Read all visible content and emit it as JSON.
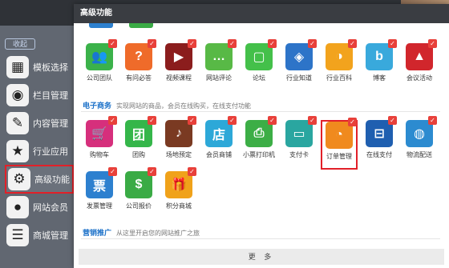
{
  "sidebar": {
    "collapse_label": "收起",
    "items": [
      {
        "label": "模板选择",
        "icon": "grid-icon",
        "glyph": "▦"
      },
      {
        "label": "栏目管理",
        "icon": "target-icon",
        "glyph": "◉"
      },
      {
        "label": "内容管理",
        "icon": "edit-icon",
        "glyph": "✎"
      },
      {
        "label": "行业应用",
        "icon": "star-icon",
        "glyph": "★"
      },
      {
        "label": "高级功能",
        "icon": "gear-icon",
        "glyph": "⚙"
      },
      {
        "label": "网站会员",
        "icon": "user-icon",
        "glyph": "●"
      },
      {
        "label": "商城管理",
        "icon": "cart-icon",
        "glyph": "☰"
      }
    ]
  },
  "modal": {
    "title": "高级功能",
    "more_label": "更 多"
  },
  "sections": {
    "ecommerce": {
      "title": "电子商务",
      "subtitle": "实现网站的商品，会员在线购买，在线支付功能"
    },
    "marketing": {
      "title": "营销推广",
      "subtitle": "从这里开启您的网站推广之旅"
    }
  },
  "apps_row1": [
    {
      "name": "公司团队",
      "glyph": "👥",
      "color": "#3bb24a"
    },
    {
      "name": "有问必答",
      "glyph": "?",
      "color": "#ef6b2a"
    },
    {
      "name": "视频课程",
      "glyph": "▶",
      "color": "#8b1d1d"
    },
    {
      "name": "网站评论",
      "glyph": "…",
      "color": "#58b946"
    },
    {
      "name": "论坛",
      "glyph": "▢",
      "color": "#44c04a"
    },
    {
      "name": "行业知道",
      "glyph": "◈",
      "color": "#2d74c8"
    },
    {
      "name": "行业百科",
      "glyph": "◑",
      "color": "#f2a31d"
    },
    {
      "name": "博客",
      "glyph": "b",
      "color": "#39a9dc"
    },
    {
      "name": "会议活动",
      "glyph": "▲",
      "color": "#d1262c"
    }
  ],
  "apps_row2": [
    {
      "name": "购物车",
      "glyph": "🛒",
      "color": "#d62f7c"
    },
    {
      "name": "团购",
      "glyph": "团",
      "color": "#35b64a"
    },
    {
      "name": "场地预定",
      "glyph": "♪",
      "color": "#7a3a22"
    },
    {
      "name": "会员商铺",
      "glyph": "店",
      "color": "#2da8d8"
    },
    {
      "name": "小票打印机",
      "glyph": "⎙",
      "color": "#3cae46"
    },
    {
      "name": "支付卡",
      "glyph": "▭",
      "color": "#2aa6a0"
    },
    {
      "name": "订单管理",
      "glyph": "◔",
      "color": "#f08a1e"
    },
    {
      "name": "在线支付",
      "glyph": "⊟",
      "color": "#1f5fb0"
    },
    {
      "name": "物流配送",
      "glyph": "◍",
      "color": "#2c8bd0"
    }
  ],
  "apps_row3": [
    {
      "name": "发票管理",
      "glyph": "票",
      "color": "#2d80cf"
    },
    {
      "name": "公司报价",
      "glyph": "$",
      "color": "#3aab45"
    },
    {
      "name": "积分商城",
      "glyph": "🎁",
      "color": "#f0a21a"
    }
  ],
  "check_glyph": "✓"
}
